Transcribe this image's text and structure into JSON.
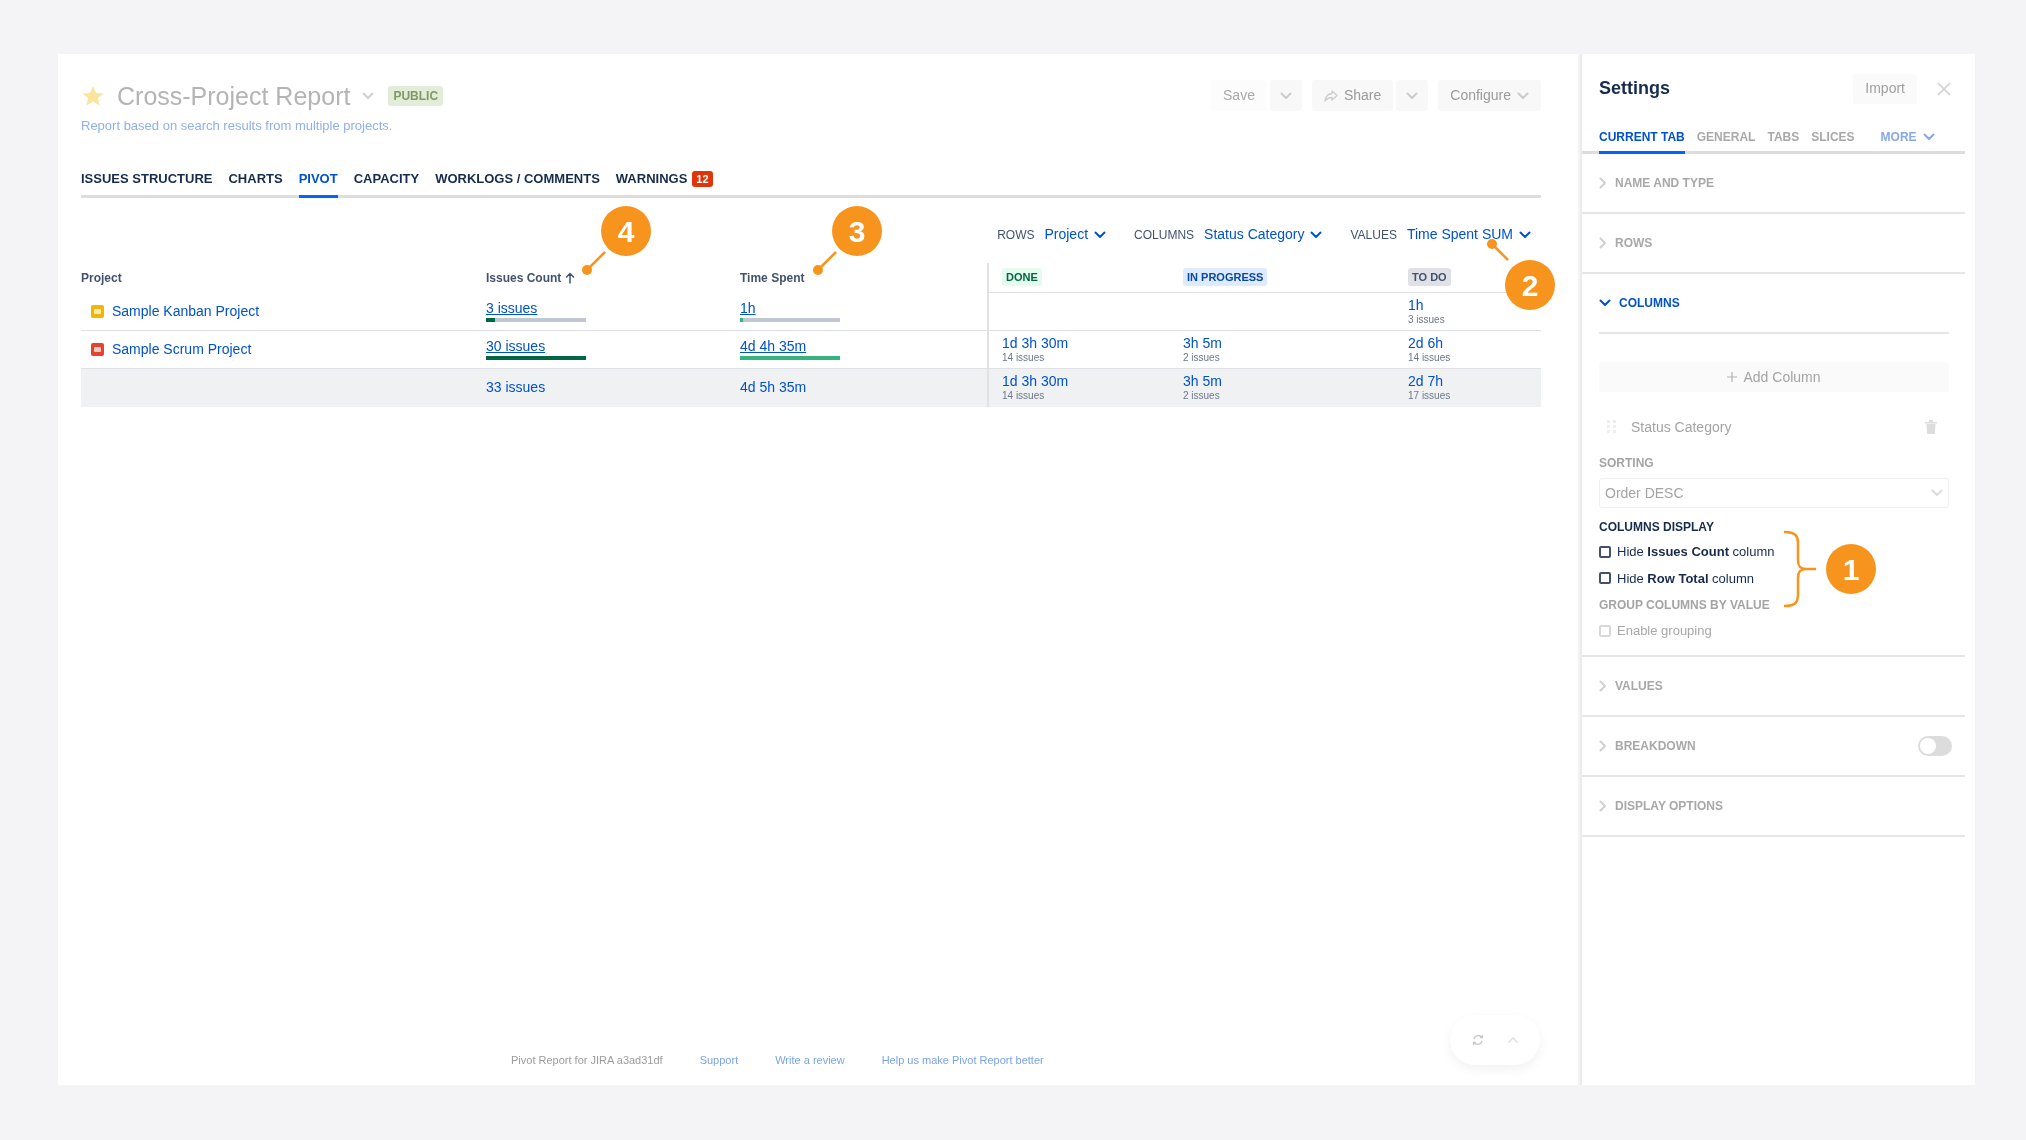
{
  "report": {
    "title": "Cross-Project Report",
    "badge": "PUBLIC",
    "description": "Report based on search results from multiple projects.",
    "starred": true
  },
  "actions": [
    {
      "label": "Save",
      "kind": "split"
    },
    {
      "label": "Share",
      "kind": "share"
    },
    {
      "label": "Configure",
      "kind": "dropdown"
    }
  ],
  "tabs": [
    {
      "label": "ISSUES STRUCTURE",
      "selected": false
    },
    {
      "label": "CHARTS",
      "selected": false
    },
    {
      "label": "PIVOT",
      "selected": true
    },
    {
      "label": "CAPACITY",
      "selected": false
    },
    {
      "label": "WORKLOGS / COMMENTS",
      "selected": false
    },
    {
      "label": "WARNINGS",
      "selected": false,
      "badge": "12"
    }
  ],
  "pivot_options": [
    {
      "label": "ROWS",
      "value": "Project"
    },
    {
      "label": "COLUMNS",
      "value": "Status Category"
    },
    {
      "label": "VALUES",
      "value": "Time Spent SUM"
    }
  ],
  "table": {
    "columns": [
      {
        "label": "Project",
        "sorted": false
      },
      {
        "label": "Issues Count",
        "sorted": true
      },
      {
        "label": "Time Spent",
        "sorted": false
      }
    ],
    "status_columns": [
      {
        "label": "DONE",
        "kind": "done"
      },
      {
        "label": "IN PROGRESS",
        "kind": "in_progress"
      },
      {
        "label": "TO DO",
        "kind": "todo"
      }
    ],
    "rows": [
      {
        "project": "Sample Kanban Project",
        "color": "#f5b400",
        "issues": {
          "text": "3 issues",
          "level": 0.09
        },
        "time": {
          "text": "1h",
          "level": 0.03
        },
        "cells": [
          {},
          {},
          {
            "value": "1h",
            "sub": "3 issues"
          }
        ]
      },
      {
        "project": "Sample Scrum Project",
        "color": "#e2442f",
        "issues": {
          "text": "30 issues",
          "level": 1
        },
        "time": {
          "text": "4d 4h 35m",
          "level": 1
        },
        "cells": [
          {
            "value": "1d 3h 30m",
            "sub": "14 issues"
          },
          {
            "value": "3h 5m",
            "sub": "2 issues"
          },
          {
            "value": "2d 6h",
            "sub": "14 issues"
          }
        ]
      }
    ],
    "total": {
      "issues": "33 issues",
      "time": "4d 5h 35m",
      "cells": [
        {
          "value": "1d 3h 30m",
          "sub": "14 issues"
        },
        {
          "value": "3h 5m",
          "sub": "2 issues"
        },
        {
          "value": "2d 7h",
          "sub": "17 issues"
        }
      ]
    }
  },
  "settings": {
    "title": "Settings",
    "import": "Import",
    "tabs": [
      {
        "label": "CURRENT TAB",
        "selected": true,
        "kind": "tab"
      },
      {
        "label": "GENERAL",
        "selected": false,
        "kind": "tab"
      },
      {
        "label": "TABS",
        "selected": false,
        "kind": "tab"
      },
      {
        "label": "SLICES",
        "selected": false,
        "kind": "tab"
      },
      {
        "label": "MORE",
        "selected": false,
        "kind": "dropdown"
      }
    ],
    "sections": [
      {
        "label": "NAME AND TYPE",
        "expanded": false
      },
      {
        "label": "ROWS",
        "expanded": false
      },
      {
        "label": "COLUMNS",
        "expanded": true,
        "body": {
          "add_button": "Add Column",
          "column_item": "Status Category",
          "sorting_label": "SORTING",
          "sorting_value": "Order DESC",
          "display_label": "COLUMNS DISPLAY",
          "display_options": [
            {
              "label": "Hide **Issues Count** column",
              "checked": false
            },
            {
              "label": "Hide **Row Total** column",
              "checked": false
            }
          ],
          "group_label": "GROUP COLUMNS BY VALUE",
          "group_option": {
            "label": "Enable grouping",
            "checked": false,
            "disabled": true
          }
        }
      },
      {
        "label": "VALUES",
        "expanded": false
      },
      {
        "label": "BREAKDOWN",
        "expanded": false,
        "toggle": {
          "on": false
        }
      },
      {
        "label": "DISPLAY OPTIONS",
        "expanded": false
      }
    ]
  },
  "footer": {
    "text": "Pivot Report for JIRA a3ad31df",
    "links": [
      "Support",
      "Write a review",
      "Help us make Pivot Report better"
    ]
  },
  "annotations": [
    {
      "label": "1"
    },
    {
      "label": "2"
    },
    {
      "label": "3"
    },
    {
      "label": "4"
    }
  ]
}
